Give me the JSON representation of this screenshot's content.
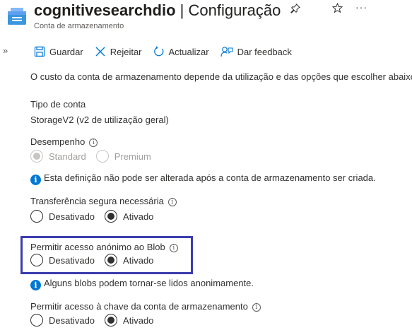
{
  "header": {
    "resource_name": "cognitivesearchdio",
    "separator": " | ",
    "page_name": "Configuração",
    "subtitle": "Conta de armazenamento",
    "pin_icon": "pin-icon",
    "favorite_icon": "star-icon",
    "more_icon": "ellipsis-icon"
  },
  "toolbar": {
    "save_label": "Guardar",
    "discard_label": "Rejeitar",
    "refresh_label": "Actualizar",
    "feedback_label": "Dar feedback"
  },
  "main": {
    "intro": "O custo da conta de armazenamento depende da utilização e das opções que escolher abaixo.",
    "account_type_label": "Tipo de conta",
    "account_type_value": "StorageV2 (v2 de utilização geral)",
    "performance": {
      "label": "Desempenho",
      "options": [
        "Standard",
        "Premium"
      ],
      "selected": "Standard",
      "disabled": true,
      "note": "Esta definição não pode ser alterada após a conta de armazenamento ser criada."
    },
    "secure_transfer": {
      "label": "Transferência segura necessária",
      "options": [
        "Desativado",
        "Ativado"
      ],
      "selected": "Ativado"
    },
    "anonymous_blob": {
      "label": "Permitir acesso anónimo ao Blob",
      "options": [
        "Desativado",
        "Ativado"
      ],
      "selected": "Ativado",
      "note": "Alguns blobs podem tornar-se lidos anonimamente."
    },
    "key_access": {
      "label": "Permitir acesso à chave da conta de armazenamento",
      "options": [
        "Desativado",
        "Ativado"
      ],
      "selected": "Ativado"
    }
  },
  "colors": {
    "highlight_border": "#3c3cae",
    "info_blue": "#0078d4",
    "icon_blue": "#0078d4"
  }
}
